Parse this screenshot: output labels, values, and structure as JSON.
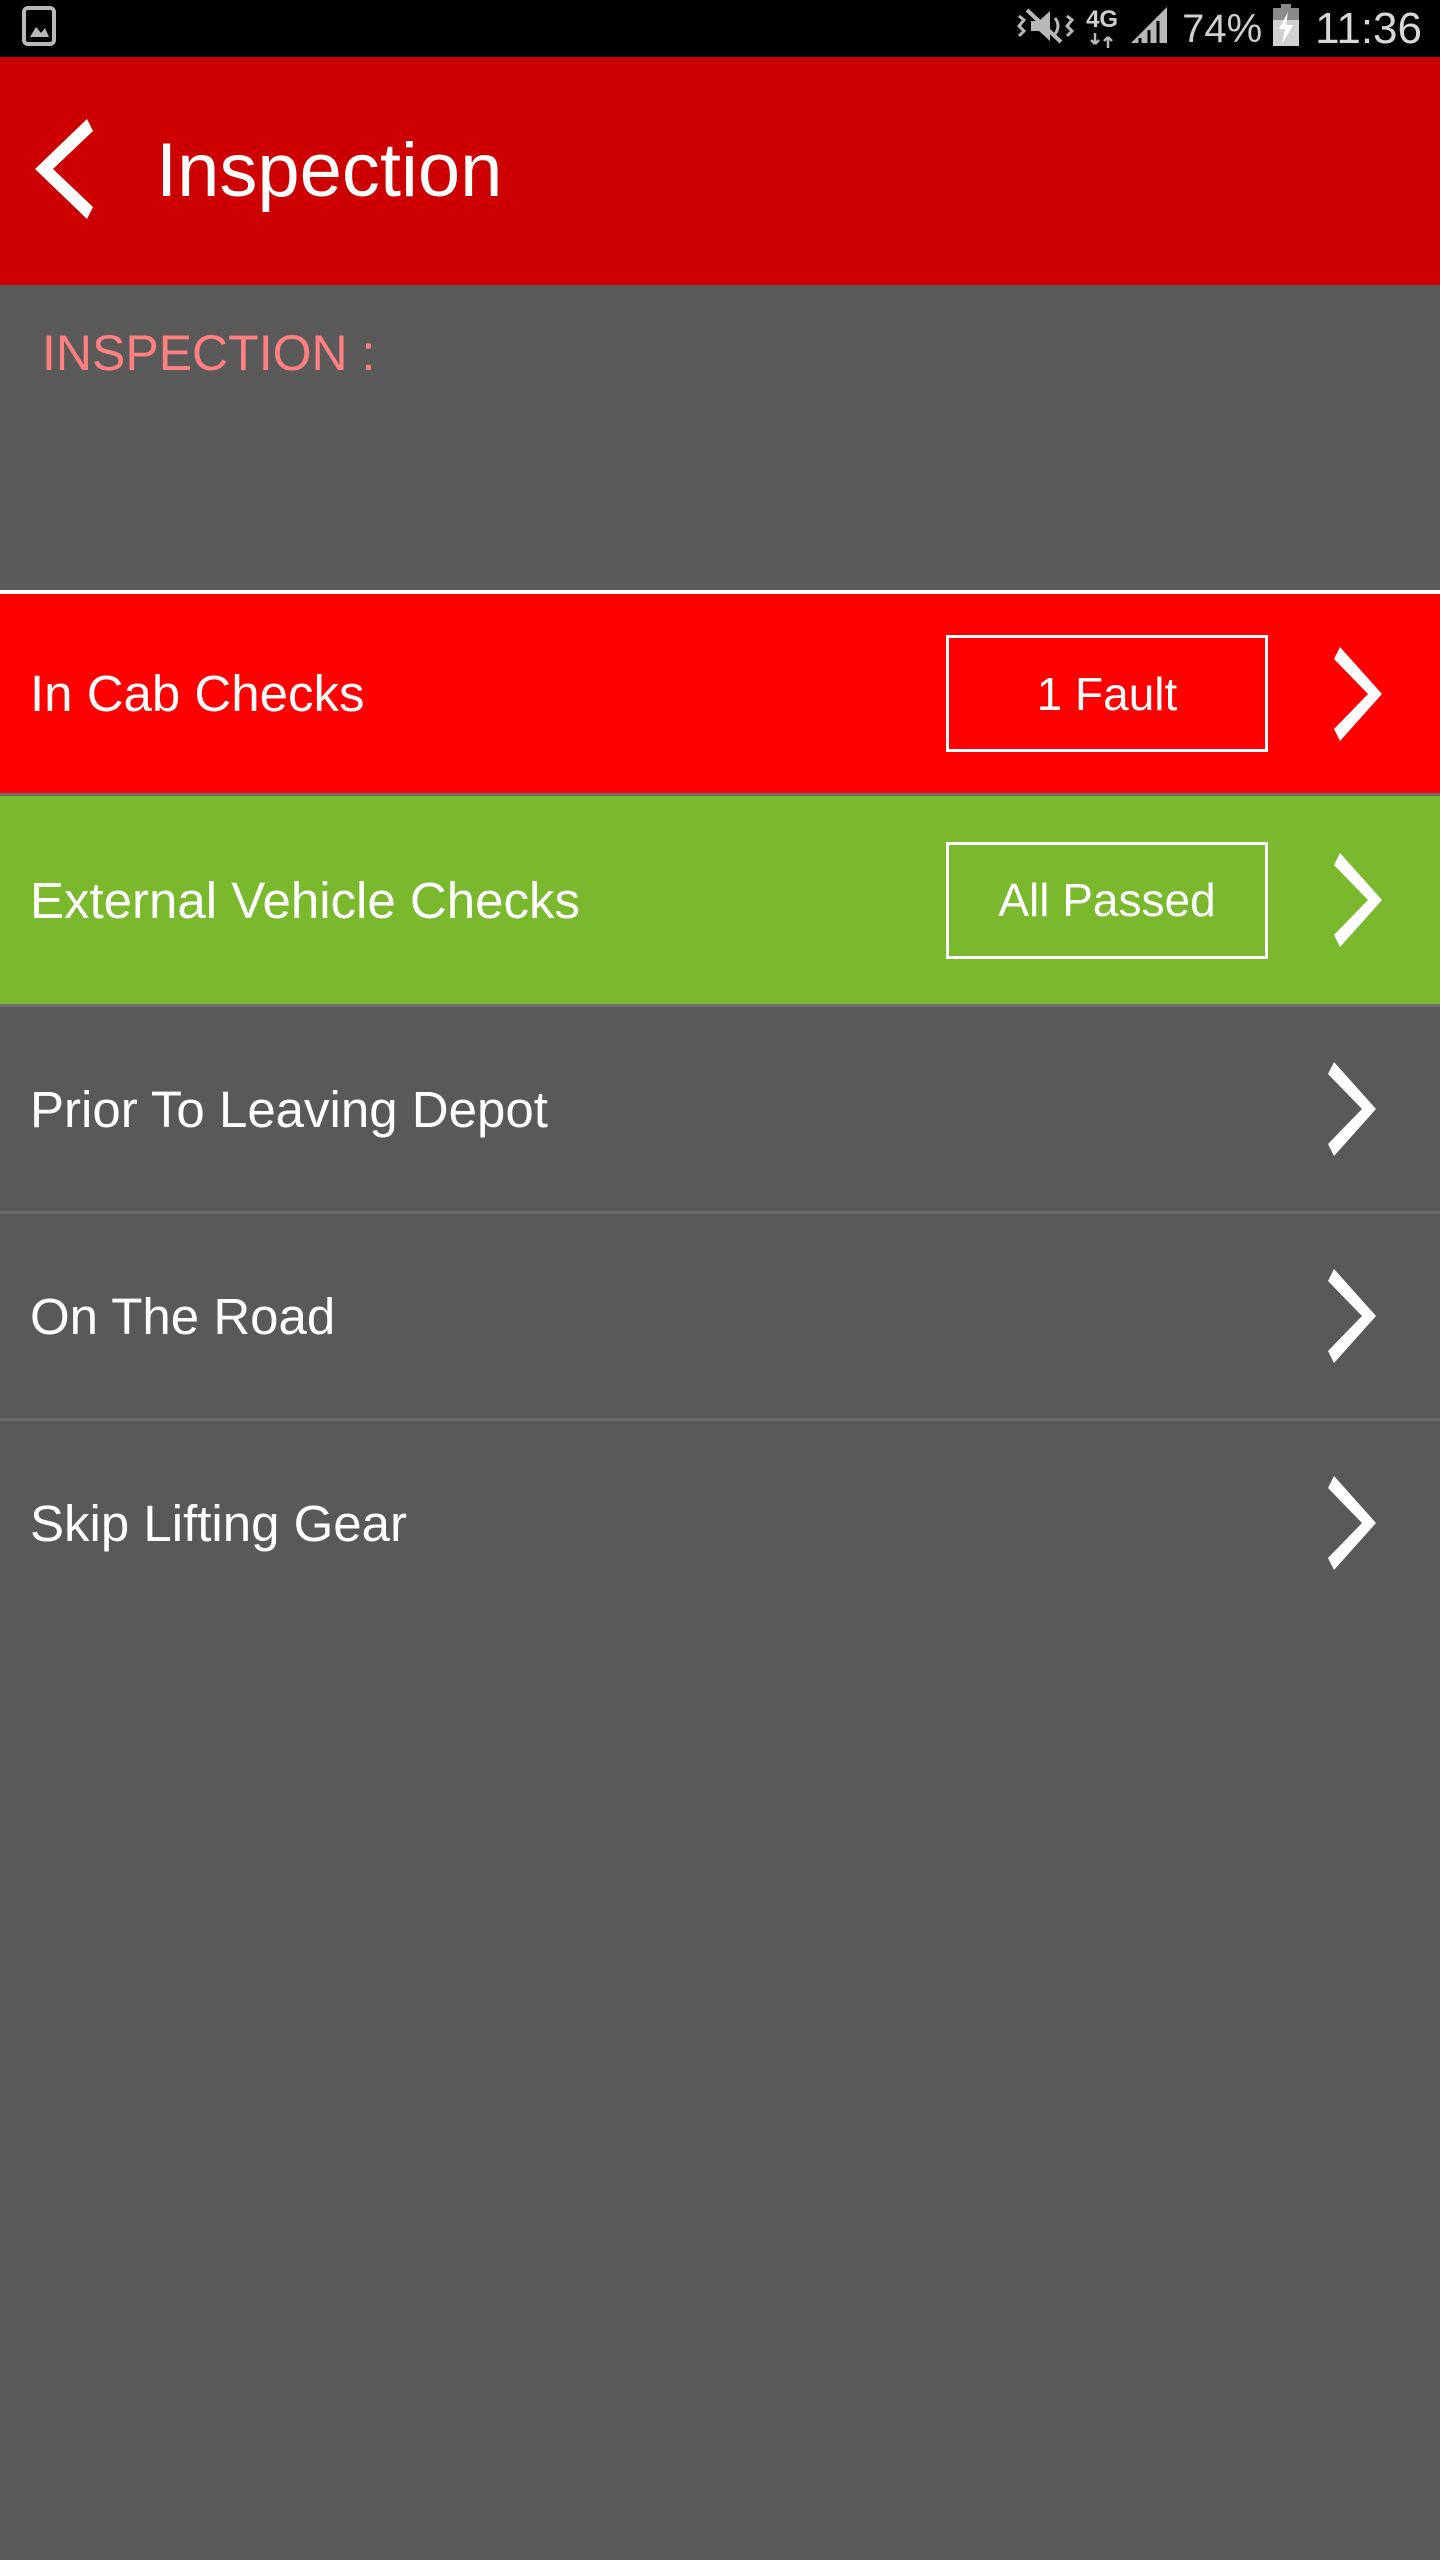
{
  "status_bar": {
    "left_icon": "image-notification-icon",
    "icons": [
      "vibrate-mute-icon",
      "4g-data-icon",
      "signal-bars-icon"
    ],
    "network_label": "4G",
    "battery_percent": "74%",
    "battery_icon": "battery-charging-icon",
    "clock": "11:36"
  },
  "header": {
    "back_icon": "back-chevron-icon",
    "title": "Inspection",
    "background": "#cc0000"
  },
  "section": {
    "label": "INSPECTION :",
    "label_color": "#ff8080",
    "background": "#5a5a5a"
  },
  "list": {
    "rows": [
      {
        "label": "In Cab Checks",
        "badge": "1 Fault",
        "status": "fault",
        "background": "#ff0000",
        "chevron": "chevron-right-icon"
      },
      {
        "label": "External Vehicle Checks",
        "badge": "All Passed",
        "status": "passed",
        "background": "#7ab82e",
        "chevron": "chevron-right-icon"
      },
      {
        "label": "Prior To Leaving Depot",
        "badge": null,
        "status": "none",
        "background": "#595959",
        "chevron": "chevron-right-icon"
      },
      {
        "label": "On The Road",
        "badge": null,
        "status": "none",
        "background": "#595959",
        "chevron": "chevron-right-icon"
      },
      {
        "label": "Skip Lifting Gear",
        "badge": null,
        "status": "none",
        "background": "#595959",
        "chevron": "chevron-right-icon"
      }
    ]
  }
}
